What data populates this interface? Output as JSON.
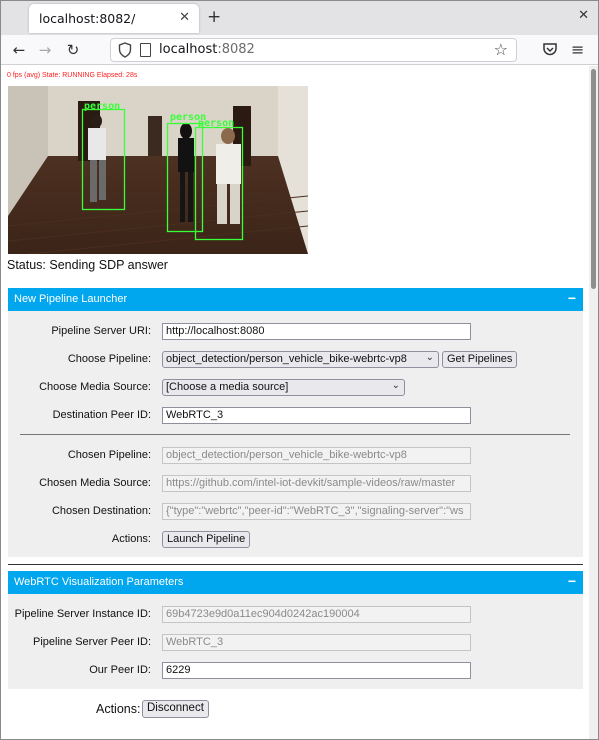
{
  "browser": {
    "tab_title": "localhost:8082/",
    "url_host": "localhost",
    "url_port": ":8082"
  },
  "page": {
    "fps_text": "0 fps (avg) State: RUNNING Elapsed: 28s",
    "status_text": "Status: Sending SDP answer",
    "detections": [
      {
        "label": "person"
      },
      {
        "label": "person"
      },
      {
        "label": "person"
      }
    ]
  },
  "launcher": {
    "title": "New Pipeline Launcher",
    "toggle": "−",
    "server_uri_label": "Pipeline Server URI:",
    "server_uri_value": "http://localhost:8080",
    "choose_pipeline_label": "Choose Pipeline:",
    "choose_pipeline_value": "object_detection/person_vehicle_bike-webrtc-vp8",
    "get_pipelines_button": "Get Pipelines",
    "media_source_label": "Choose Media Source:",
    "media_source_value": "[Choose a media source]",
    "dest_peer_label": "Destination Peer ID:",
    "dest_peer_value": "WebRTC_3",
    "chosen_pipeline_label": "Chosen Pipeline:",
    "chosen_pipeline_value": "object_detection/person_vehicle_bike-webrtc-vp8",
    "chosen_media_label": "Chosen Media Source:",
    "chosen_media_value": "https://github.com/intel-iot-devkit/sample-videos/raw/master",
    "chosen_dest_label": "Chosen Destination:",
    "chosen_dest_value": "{\"type\":\"webrtc\",\"peer-id\":\"WebRTC_3\",\"signaling-server\":\"ws",
    "actions_label": "Actions:",
    "launch_button": "Launch Pipeline"
  },
  "webrtc": {
    "title": "WebRTC Visualization Parameters",
    "toggle": "−",
    "instance_id_label": "Pipeline Server Instance ID:",
    "instance_id_value": "69b4723e9d0a11ec904d0242ac190004",
    "server_peer_label": "Pipeline Server Peer ID:",
    "server_peer_value": "WebRTC_3",
    "our_peer_label": "Our Peer ID:",
    "our_peer_value": "6229"
  },
  "footer": {
    "actions_label": "Actions:",
    "disconnect_button": "Disconnect"
  }
}
